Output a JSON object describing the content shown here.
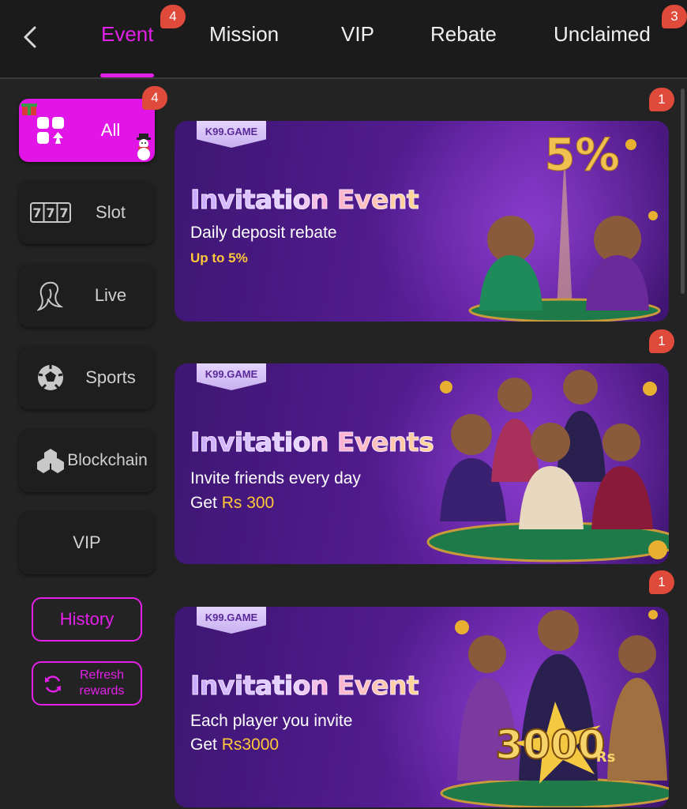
{
  "header": {
    "tabs": [
      {
        "label": "Event",
        "badge": "4"
      },
      {
        "label": "Mission"
      },
      {
        "label": "VIP"
      },
      {
        "label": "Rebate"
      },
      {
        "label": "Unclaimed",
        "badge": "3"
      }
    ],
    "accent": "#e320e8"
  },
  "sidebar": {
    "items": [
      {
        "label": "All",
        "badge": "4",
        "icon": "grid-icon"
      },
      {
        "label": "Slot",
        "icon": "slot-777-icon"
      },
      {
        "label": "Live",
        "icon": "live-dealer-icon"
      },
      {
        "label": "Sports",
        "icon": "soccer-ball-icon"
      },
      {
        "label": "Blockchain",
        "icon": "blockchain-icon"
      },
      {
        "label": "VIP"
      }
    ],
    "history_label": "History",
    "refresh_label": "Refresh rewards"
  },
  "banners": [
    {
      "brand": "K99.GAME",
      "title_a": "Invitation",
      "title_b": "Event",
      "subtitle": "Daily deposit rebate",
      "highlight": "Up to 5%",
      "art_text": "5%",
      "badge": "1"
    },
    {
      "brand": "K99.GAME",
      "title_a": "Invitation",
      "title_b": "Events",
      "subtitle": "Invite friends every day",
      "get_prefix": "Get",
      "get_amount": "Rs 300",
      "badge": "1"
    },
    {
      "brand": "K99.GAME",
      "title_a": "Invitation",
      "title_b": "Event",
      "subtitle": "Each player you invite",
      "get_prefix": "Get",
      "get_amount": "Rs3000",
      "art_text": "3000",
      "art_unit": "Rs",
      "badge": "1"
    }
  ]
}
